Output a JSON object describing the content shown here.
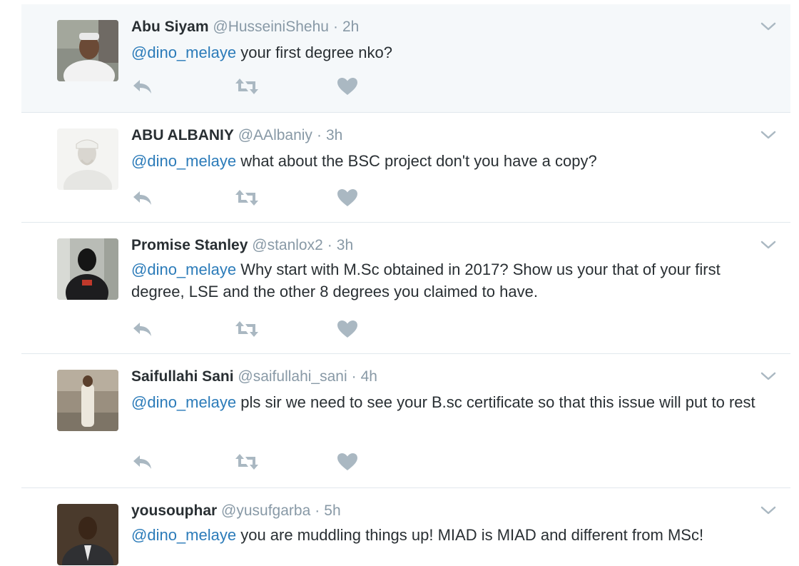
{
  "tweets": [
    {
      "fullname": "Abu Siyam",
      "handle": "@HusseiniShehu",
      "time": "2h",
      "mention": "@dino_melaye",
      "text": " your first degree nko?"
    },
    {
      "fullname": "ABU ALBANIY",
      "handle": "@AAlbaniy",
      "time": "3h",
      "mention": "@dino_melaye",
      "text": " what about the BSC project don't you have a copy?"
    },
    {
      "fullname": "Promise Stanley",
      "handle": "@stanlox2",
      "time": "3h",
      "mention": "@dino_melaye",
      "text": " Why start with M.Sc obtained in 2017? Show us your that of your first degree, LSE and the other 8 degrees you claimed to have."
    },
    {
      "fullname": "Saifullahi Sani",
      "handle": "@saifullahi_sani",
      "time": "4h",
      "mention": "@dino_melaye",
      "text": " pls sir we need to see your B.sc certificate so that this issue will put to rest"
    },
    {
      "fullname": "yousouphar",
      "handle": "@yusufgarba",
      "time": "5h",
      "mention": "@dino_melaye",
      "text": " you are muddling things up! MIAD is MIAD and different from MSc!"
    }
  ],
  "separator": "·",
  "icons": {
    "reply": "reply-icon",
    "retweet": "retweet-icon",
    "like": "heart-icon",
    "more": "chevron-down-icon"
  },
  "colors": {
    "mention": "#2b7bb9",
    "meta": "#8899a6",
    "icon": "#aab8c2",
    "highlight_bg": "#f5f8fa"
  }
}
